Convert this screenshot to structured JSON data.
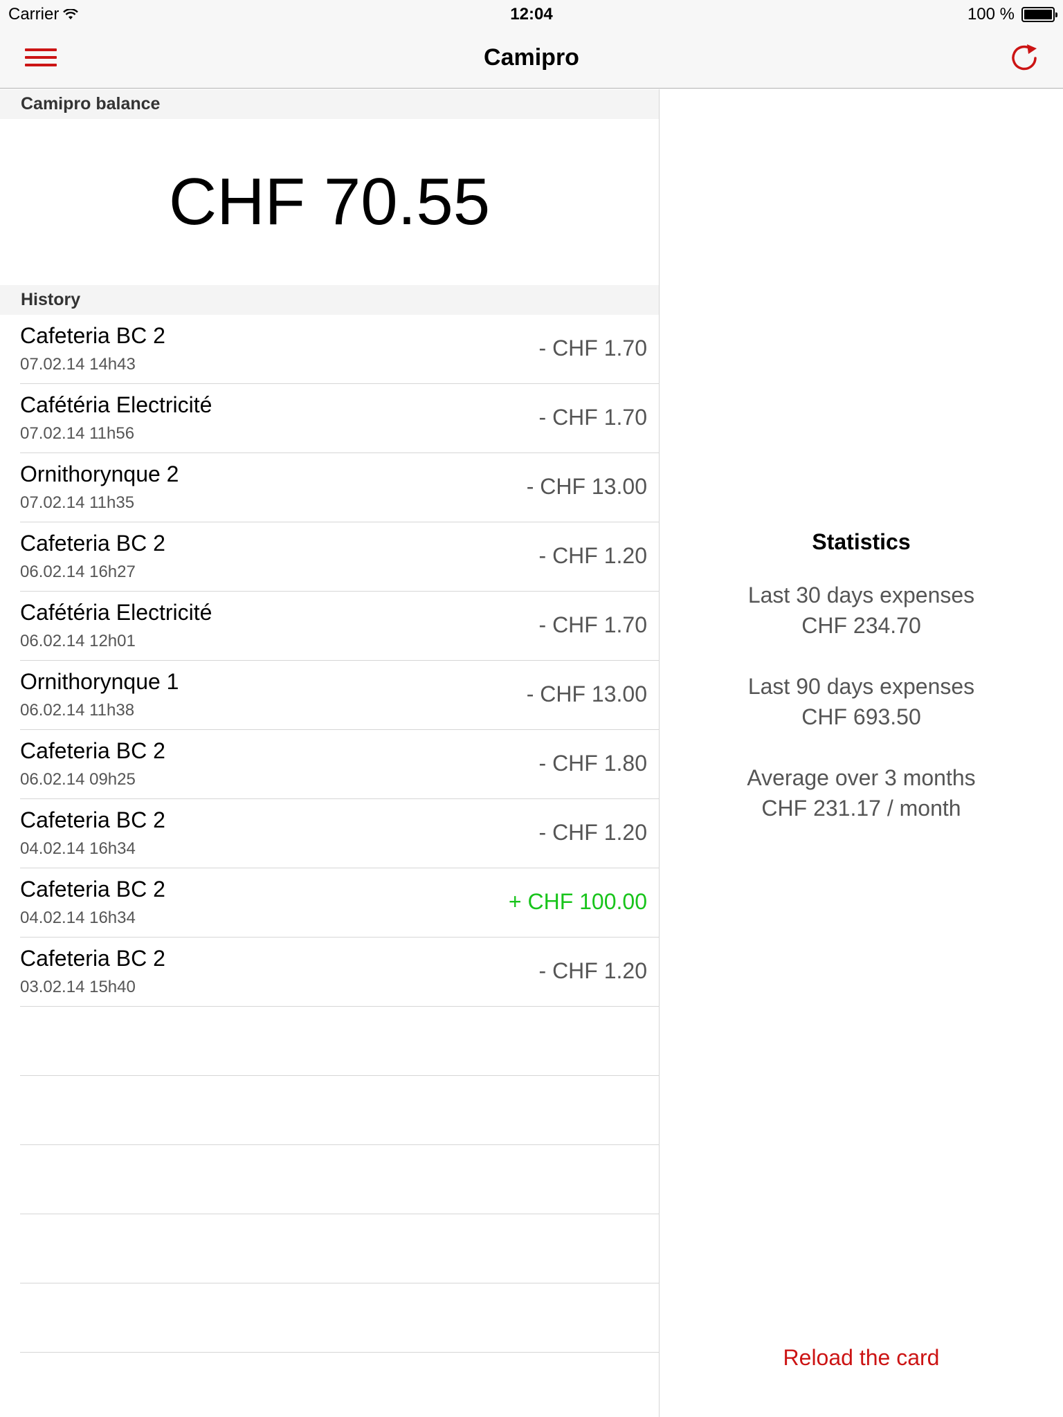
{
  "status": {
    "carrier": "Carrier",
    "time": "12:04",
    "battery_text": "100 %"
  },
  "nav": {
    "title": "Camipro"
  },
  "balance_section": {
    "header": "Camipro balance",
    "amount": "CHF 70.55"
  },
  "history_section": {
    "header": "History",
    "items": [
      {
        "place": "Cafeteria BC 2",
        "date": "07.02.14 14h43",
        "amount": "- CHF 1.70",
        "type": "debit"
      },
      {
        "place": "Cafétéria Electricité",
        "date": "07.02.14 11h56",
        "amount": "- CHF 1.70",
        "type": "debit"
      },
      {
        "place": "Ornithorynque 2",
        "date": "07.02.14 11h35",
        "amount": "- CHF 13.00",
        "type": "debit"
      },
      {
        "place": "Cafeteria BC 2",
        "date": "06.02.14 16h27",
        "amount": "- CHF 1.20",
        "type": "debit"
      },
      {
        "place": "Cafétéria Electricité",
        "date": "06.02.14 12h01",
        "amount": "- CHF 1.70",
        "type": "debit"
      },
      {
        "place": "Ornithorynque 1",
        "date": "06.02.14 11h38",
        "amount": "- CHF 13.00",
        "type": "debit"
      },
      {
        "place": "Cafeteria BC 2",
        "date": "06.02.14 09h25",
        "amount": "- CHF 1.80",
        "type": "debit"
      },
      {
        "place": "Cafeteria BC 2",
        "date": "04.02.14 16h34",
        "amount": "- CHF 1.20",
        "type": "debit"
      },
      {
        "place": "Cafeteria BC 2",
        "date": "04.02.14 16h34",
        "amount": "+ CHF 100.00",
        "type": "credit"
      },
      {
        "place": "Cafeteria BC 2",
        "date": "03.02.14 15h40",
        "amount": "- CHF 1.20",
        "type": "debit"
      }
    ]
  },
  "statistics": {
    "title": "Statistics",
    "items": [
      {
        "label": "Last 30 days expenses",
        "value": "CHF 234.70"
      },
      {
        "label": "Last 90 days expenses",
        "value": "CHF 693.50"
      },
      {
        "label": "Average over 3 months",
        "value": "CHF 231.17 / month"
      }
    ]
  },
  "reload_label": "Reload the card",
  "colors": {
    "accent": "#cc1414",
    "credit": "#18c41b",
    "debit": "#555555"
  }
}
